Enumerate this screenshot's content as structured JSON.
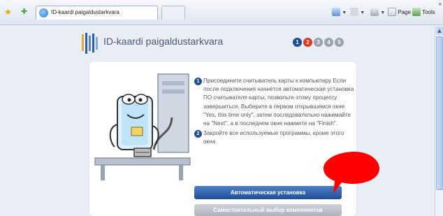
{
  "browser": {
    "tab_title": "ID-kaardi paigaldustarkvara",
    "commands": {
      "page_label": "Page",
      "tools_label": "Tools"
    },
    "icons": [
      "favorites-star-icon",
      "add-favorite-icon",
      "home-icon",
      "feeds-icon",
      "print-icon",
      "page-icon",
      "tools-icon",
      "close-icon"
    ]
  },
  "header": {
    "title": "ID-kaardi paigaldustarkvara",
    "steps": [
      "1",
      "2",
      "3",
      "4",
      "5"
    ],
    "active_step": "2",
    "colors": {
      "step_done": "#1e4f96",
      "step_active": "#e03a25",
      "step_future": "#9aa3ad"
    }
  },
  "instructions": {
    "step1_number": "1",
    "step1_text": "Присоедините считыватель карты к компьютеру Если после подключения начнётся автоматическая установка ПО считывателя карты, позвольте этому процессу завершиться. Выберите в первом открывшемся окне \"Yes, this time only\", затем последовательно нажимайте на \"Next\", а в последнем окне нажмите на \"Finish\".",
    "step2_number": "2",
    "step2_text": "Закройте все используемые программы, кроме этого окна"
  },
  "buttons": {
    "primary": "Автоматическая установка",
    "secondary": "Самостоятельный выбор компонентов"
  },
  "annotation": {
    "marker_color": "#ff0000"
  }
}
